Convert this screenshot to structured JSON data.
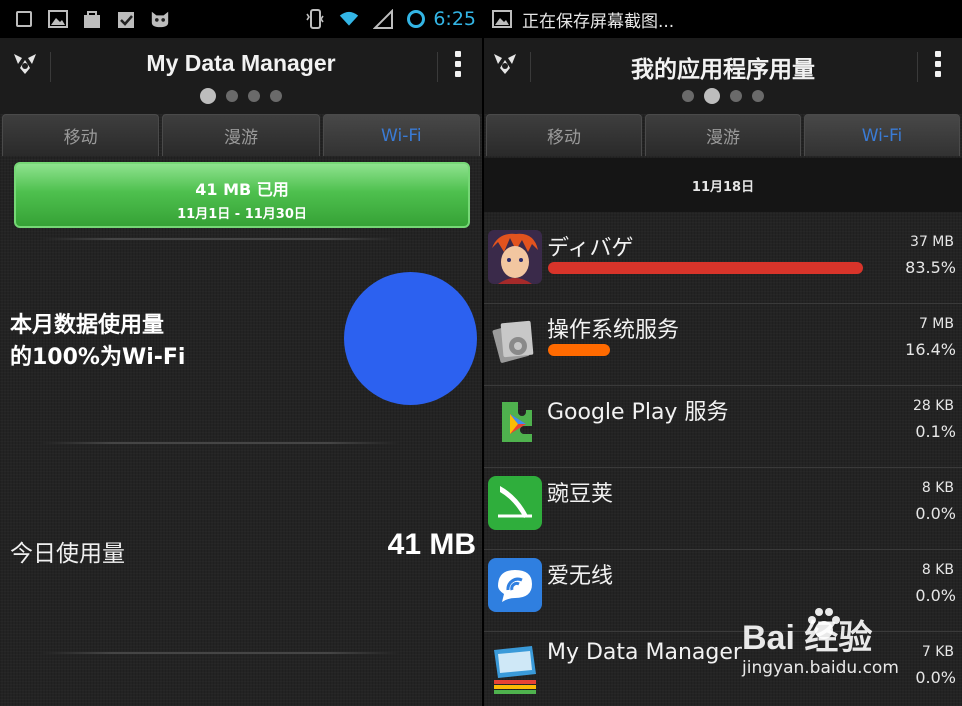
{
  "left": {
    "status": {
      "time": "6:25"
    },
    "title": "My Data Manager",
    "page_dots": {
      "count": 4,
      "active": 0
    },
    "tabs": [
      {
        "label": "移动"
      },
      {
        "label": "漫游"
      },
      {
        "label": "Wi-Fi",
        "selected": true
      }
    ],
    "used": {
      "main": "41 MB 已用",
      "range": "11月1日 - 11月30日",
      "color": "#4ec04e"
    },
    "wifi_note_line1": "本月数据使用量",
    "wifi_note_line2": "的100%为Wi-Fi",
    "pie": {
      "wifi_fraction": 1.0,
      "color": "#2c61f0"
    },
    "today": {
      "label": "今日使用量",
      "value": "41 MB"
    }
  },
  "right": {
    "status": {
      "notification": "正在保存屏幕截图..."
    },
    "title": "我的应用程序用量",
    "page_dots": {
      "count": 4,
      "active": 1
    },
    "tabs": [
      {
        "label": "移动"
      },
      {
        "label": "漫游"
      },
      {
        "label": "Wi-Fi",
        "selected": true
      }
    ],
    "date": "11月18日",
    "apps": [
      {
        "name": "ディバゲ",
        "size": "37 MB",
        "percent": "83.5%",
        "share": 0.835,
        "bar_color": "#d8342a",
        "icon": "game-character-icon"
      },
      {
        "name": "操作系统服务",
        "size": "7 MB",
        "percent": "16.4%",
        "share": 0.164,
        "bar_color": "#ff6a00",
        "icon": "system-service-icon"
      },
      {
        "name": "Google Play 服务",
        "size": "28 KB",
        "percent": "0.1%",
        "share": 0.001,
        "bar_color": "#ff6a00",
        "icon": "google-play-services-icon"
      },
      {
        "name": "豌豆荚",
        "size": "8 KB",
        "percent": "0.0%",
        "share": 0.0,
        "bar_color": "#ff6a00",
        "icon": "wandoujia-icon"
      },
      {
        "name": "爱无线",
        "size": "8 KB",
        "percent": "0.0%",
        "share": 0.0,
        "bar_color": "#ff6a00",
        "icon": "aiwuxian-icon"
      },
      {
        "name": "My Data Manager",
        "size": "7 KB",
        "percent": "0.0%",
        "share": 0.0,
        "bar_color": "#ff6a00",
        "icon": "my-data-manager-icon"
      }
    ]
  },
  "watermark": {
    "logo": "Bai  经验",
    "url": "jingyan.baidu.com"
  },
  "accent": "#33b5e5",
  "tab_selected_color": "#3a7bd5"
}
